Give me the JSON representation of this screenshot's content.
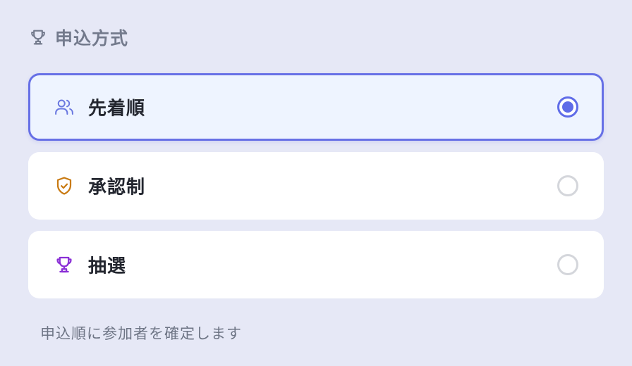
{
  "section": {
    "title": "申込方式",
    "icon": "trophy-icon"
  },
  "options": [
    {
      "label": "先着順",
      "icon": "users-icon",
      "icon_color": "#6a78e0",
      "selected": true
    },
    {
      "label": "承認制",
      "icon": "shield-check-icon",
      "icon_color": "#c97a12",
      "selected": false
    },
    {
      "label": "抽選",
      "icon": "trophy-icon",
      "icon_color": "#8a2fd6",
      "selected": false
    }
  ],
  "helper_text": "申込順に参加者を確定します",
  "colors": {
    "background": "#e6e8f6",
    "accent": "#5f6ce8",
    "selected_background": "#eef4ff"
  }
}
